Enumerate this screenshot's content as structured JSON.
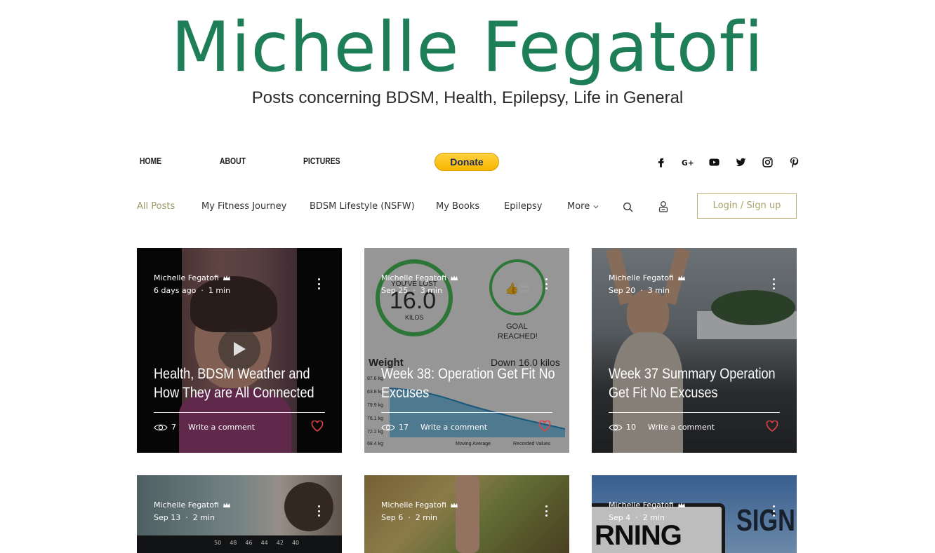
{
  "header": {
    "site_title": "Michelle Fegatofi",
    "tagline": "Posts concerning BDSM, Health, Epilepsy, Life in General"
  },
  "top_nav": {
    "items": [
      "HOME",
      "ABOUT",
      "PICTURES"
    ],
    "donate_label": "Donate",
    "social_icons": [
      "facebook-icon",
      "google-plus-icon",
      "youtube-icon",
      "twitter-icon",
      "instagram-icon",
      "pinterest-icon"
    ]
  },
  "category_nav": {
    "items": [
      "All Posts",
      "My Fitness Journey",
      "BDSM Lifestyle (NSFW)",
      "My Books",
      "Epilepsy",
      "More"
    ],
    "active": "All Posts",
    "login_label": "Login / Sign up"
  },
  "colors": {
    "title_green": "#1e7e57",
    "active_category": "#9a9a6a",
    "login_border": "#b9b37a",
    "heart_red": "#e0424a",
    "donate_yellow": "#ffc439"
  },
  "posts": [
    {
      "author": "Michelle Fegatofi",
      "date": "6 days ago",
      "read_time": "1 min",
      "title": "Health, BDSM Weather and How They are All Connected",
      "views": "7",
      "comment_label": "Write a comment"
    },
    {
      "author": "Michelle Fegatofi",
      "date": "Sep 25",
      "read_time": "3 min",
      "title": "Week 38: Operation Get Fit No Excuses",
      "views": "17",
      "comment_label": "Write a comment",
      "image_text": {
        "lost_label": "YOU'VE LOST",
        "lost_value": "16.0",
        "lost_unit": "KILOS",
        "goal_line1": "GOAL",
        "goal_line2": "REACHED!",
        "weight_label": "Weight",
        "down_label": "Down 16.0 kilos",
        "y_ticks": [
          "87.6 kg",
          "83.8 kg",
          "79.9 kg",
          "76.1 kg",
          "72.2 kg",
          "68.4 kg"
        ],
        "legend_moving": "Moving Average",
        "legend_recorded": "Recorded Values"
      }
    },
    {
      "author": "Michelle Fegatofi",
      "date": "Sep 20",
      "read_time": "3 min",
      "title": "Week 37 Summary Operation Get Fit No Excuses",
      "views": "10",
      "comment_label": "Write a comment"
    },
    {
      "author": "Michelle Fegatofi",
      "date": "Sep 13",
      "read_time": "2 min",
      "image_text": {
        "ruler": [
          "50",
          "48",
          "46",
          "44",
          "42",
          "40"
        ]
      }
    },
    {
      "author": "Michelle Fegatofi",
      "date": "Sep 6",
      "read_time": "2 min"
    },
    {
      "author": "Michelle Fegatofi",
      "date": "Sep 4",
      "read_time": "2 min",
      "image_text": {
        "sign_left": "RNING",
        "sign_right": "SIGN"
      }
    }
  ]
}
